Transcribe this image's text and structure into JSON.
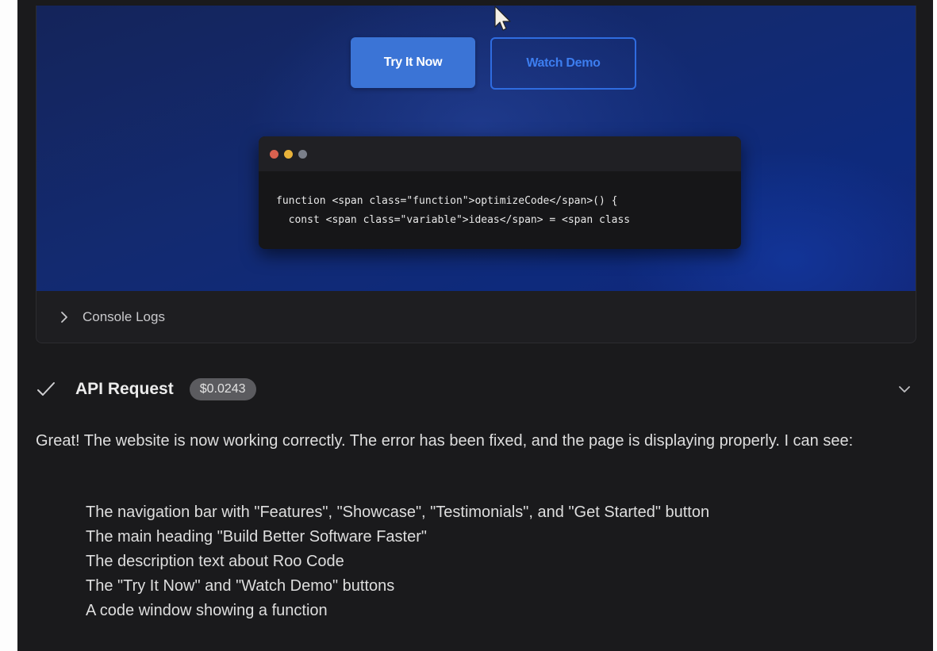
{
  "preview": {
    "primary_button": "Try It Now",
    "secondary_button": "Watch Demo",
    "code_lines": [
      "function <span class=\"function\">optimizeCode</span>() {",
      "  const <span class=\"variable\">ideas</span> = <span class"
    ],
    "console_label": "Console Logs"
  },
  "api_request": {
    "title": "API Request",
    "cost": "$0.0243"
  },
  "message": {
    "intro": "Great! The website is now working correctly. The error has been fixed, and the page is displaying properly. I can see:",
    "items": [
      "The navigation bar with \"Features\", \"Showcase\", \"Testimonials\", and \"Get Started\" button",
      "The main heading \"Build Better Software Faster\"",
      "The description text about Roo Code",
      "The \"Try It Now\" and \"Watch Demo\" buttons",
      "A code window showing a function"
    ]
  },
  "icons": {
    "console_toggle": "chevron-right-icon",
    "status": "check-icon",
    "expand": "chevron-down-icon",
    "cursor": "mouse-pointer-icon"
  },
  "colors": {
    "panel_background": "#1a1a1c",
    "preview_background": "#132a70",
    "primary_button": "#3b74d6",
    "secondary_button_border": "#2f6ce0",
    "cost_badge": "#5b5b5f"
  }
}
